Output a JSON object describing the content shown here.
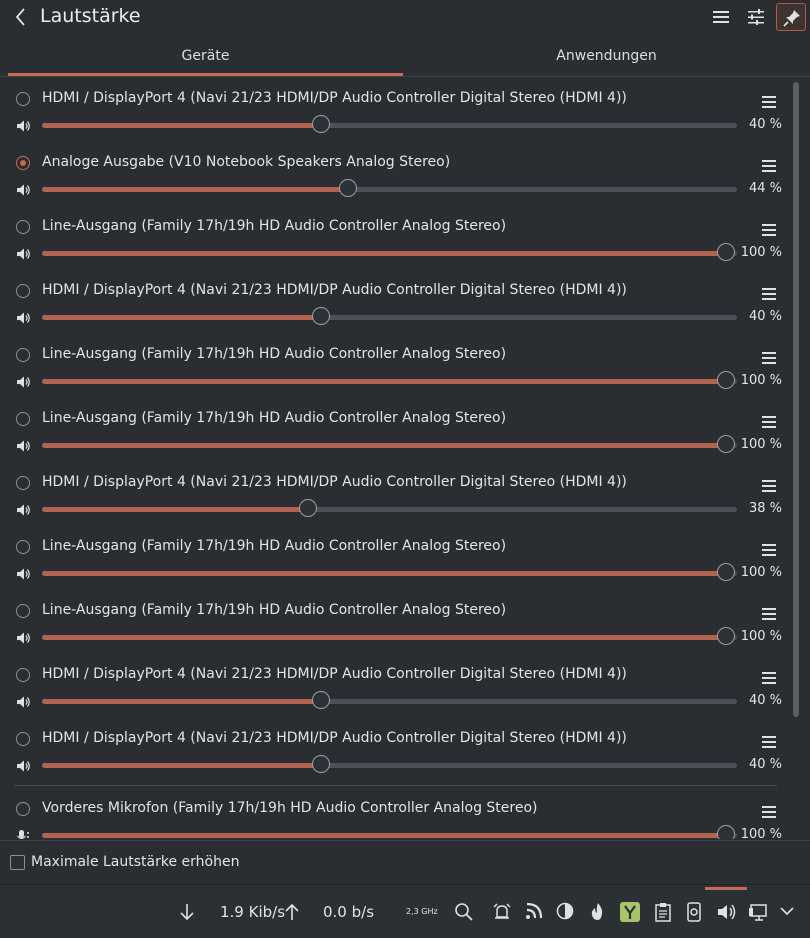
{
  "header": {
    "title": "Lautstärke"
  },
  "tabs": [
    {
      "label": "Geräte",
      "active": true
    },
    {
      "label": "Anwendungen",
      "active": false
    }
  ],
  "devices": [
    {
      "name": "HDMI / DisplayPort 4 (Navi 21/23 HDMI/DP Audio Controller Digital Stereo (HDMI 4))",
      "volume": 40,
      "volume_label": "40 %",
      "selected": false,
      "type": "output"
    },
    {
      "name": "Analoge Ausgabe (V10 Notebook Speakers Analog Stereo)",
      "volume": 44,
      "volume_label": "44 %",
      "selected": true,
      "type": "output"
    },
    {
      "name": "Line-Ausgang (Family 17h/19h HD Audio Controller Analog Stereo)",
      "volume": 100,
      "volume_label": "100 %",
      "selected": false,
      "type": "output"
    },
    {
      "name": "HDMI / DisplayPort 4 (Navi 21/23 HDMI/DP Audio Controller Digital Stereo (HDMI 4))",
      "volume": 40,
      "volume_label": "40 %",
      "selected": false,
      "type": "output"
    },
    {
      "name": "Line-Ausgang (Family 17h/19h HD Audio Controller Analog Stereo)",
      "volume": 100,
      "volume_label": "100 %",
      "selected": false,
      "type": "output"
    },
    {
      "name": "Line-Ausgang (Family 17h/19h HD Audio Controller Analog Stereo)",
      "volume": 100,
      "volume_label": "100 %",
      "selected": false,
      "type": "output"
    },
    {
      "name": "HDMI / DisplayPort 4 (Navi 21/23 HDMI/DP Audio Controller Digital Stereo (HDMI 4))",
      "volume": 38,
      "volume_label": "38 %",
      "selected": false,
      "type": "output"
    },
    {
      "name": "Line-Ausgang (Family 17h/19h HD Audio Controller Analog Stereo)",
      "volume": 100,
      "volume_label": "100 %",
      "selected": false,
      "type": "output"
    },
    {
      "name": "Line-Ausgang (Family 17h/19h HD Audio Controller Analog Stereo)",
      "volume": 100,
      "volume_label": "100 %",
      "selected": false,
      "type": "output"
    },
    {
      "name": "HDMI / DisplayPort 4 (Navi 21/23 HDMI/DP Audio Controller Digital Stereo (HDMI 4))",
      "volume": 40,
      "volume_label": "40 %",
      "selected": false,
      "type": "output"
    },
    {
      "name": "HDMI / DisplayPort 4 (Navi 21/23 HDMI/DP Audio Controller Digital Stereo (HDMI 4))",
      "volume": 40,
      "volume_label": "40 %",
      "selected": false,
      "type": "output"
    },
    {
      "name": "Vorderes Mikrofon (Family 17h/19h HD Audio Controller Analog Stereo)",
      "volume": 100,
      "volume_label": "100 %",
      "selected": false,
      "type": "input"
    }
  ],
  "options": {
    "raise_max_volume_label": "Maximale Lautstärke erhöhen",
    "raise_max_volume_checked": false
  },
  "taskbar": {
    "download_rate": "1.9 Kib/s",
    "upload_rate": "0.0 b/s",
    "cpu_freq": "2,3 GHz",
    "icons": [
      "download-arrow-icon",
      "upload-arrow-icon",
      "search-icon",
      "alarm-icon",
      "rss-icon",
      "moon-icon",
      "flame-icon",
      "yakuake-icon",
      "clipboard-icon",
      "device-icon",
      "speaker-icon",
      "display-icon",
      "chevron-down-icon"
    ]
  },
  "colors": {
    "accent": "#c86a53",
    "background": "#2a2e32",
    "track": "#4b5156",
    "fill": "#b3624f"
  }
}
